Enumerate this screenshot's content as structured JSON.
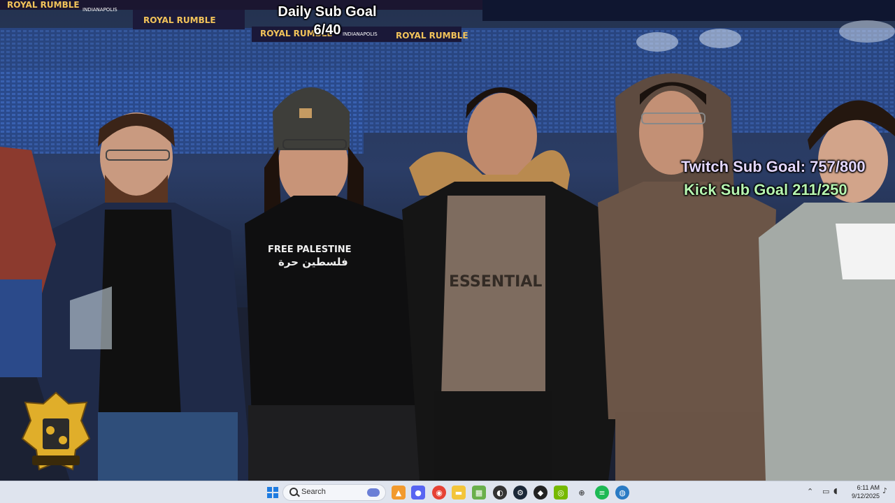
{
  "overlay": {
    "daily_goal_title": "Daily Sub Goal",
    "daily_goal_value": "6/40",
    "twitch_goal": "Twitch Sub Goal: 757/800",
    "kick_goal": "Kick Sub Goal  211/250"
  },
  "banners": [
    "ROYAL RUMBLE",
    "INDIANAPOLIS",
    "ROYAL RUMBLE",
    "INDIANAPOLIS",
    "ROYAL RUMBLE",
    "ROYAL RUMBLE"
  ],
  "shirts": {
    "free_palestine": "FREE PALESTINE",
    "free_palestine_ar": "فلسطين حرة",
    "essentials": "ESSENTIAL"
  },
  "taskbar": {
    "search_label": "Search",
    "clock_time": "6:11 AM",
    "clock_date": "9/12/2025",
    "icons": [
      "windows-start-icon",
      "search-icon",
      "task-view-icon",
      "file-explorer-icon",
      "discord-icon",
      "chrome-icon",
      "folder-icon",
      "store-icon",
      "obs-icon",
      "steam-icon",
      "app-icon",
      "nvidia-icon",
      "crosshair-icon",
      "spotify-icon",
      "globe-icon"
    ]
  },
  "colors": {
    "twitch_text": "#e3d7ff",
    "kick_text": "#b6f5b0",
    "taskbar_bg": "#dfe4ee"
  }
}
